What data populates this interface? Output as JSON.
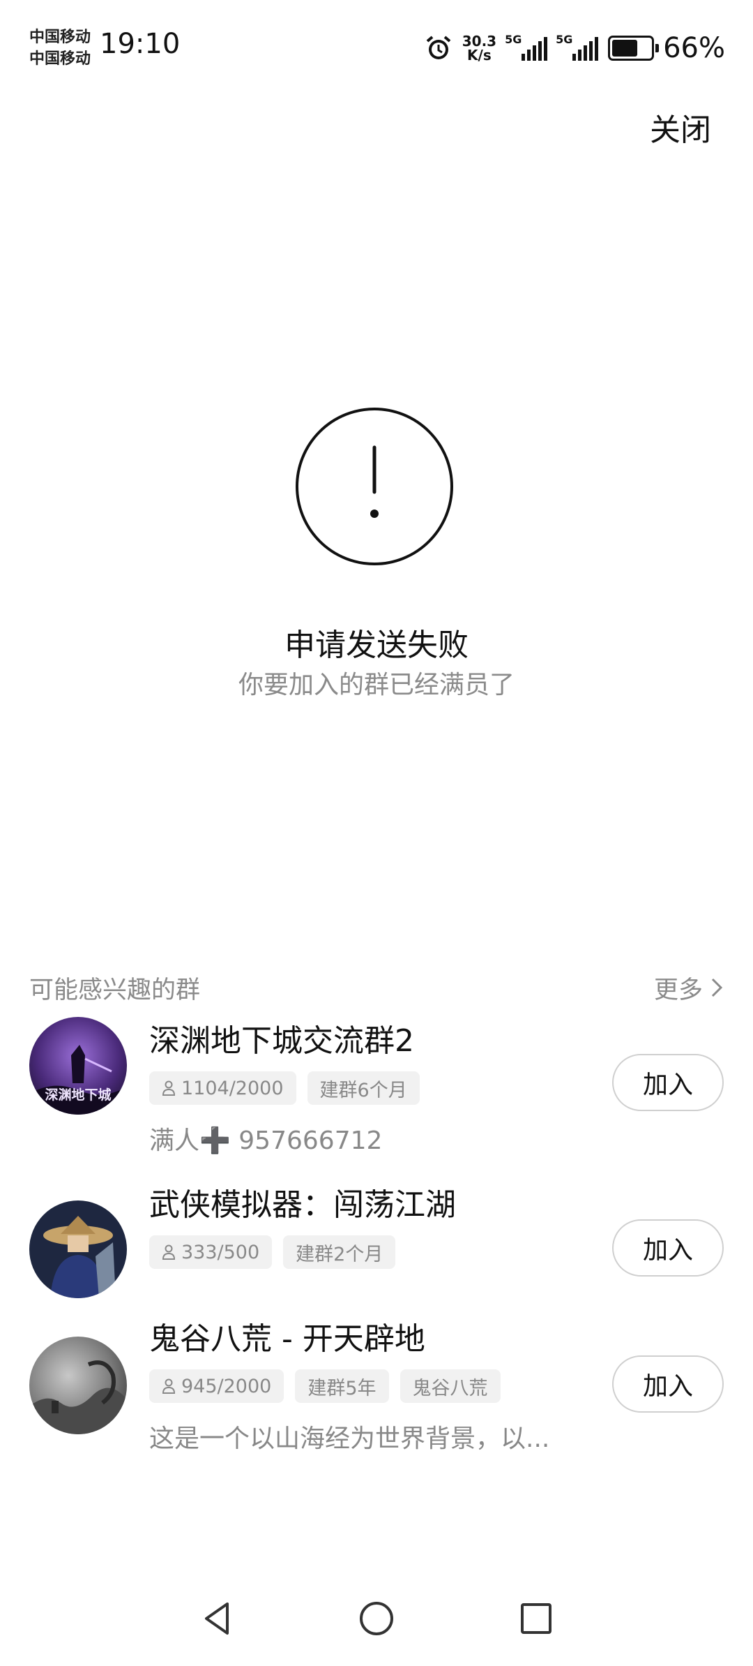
{
  "status_bar": {
    "carrier_1": "中国移动",
    "carrier_2": "中国移动",
    "time": "19:10",
    "net_speed_value": "30.3",
    "net_speed_unit": "K/s",
    "network_1": "5G",
    "network_2": "5G",
    "battery_percent": "66%",
    "battery_level": 0.66
  },
  "header": {
    "close_label": "关闭"
  },
  "result": {
    "icon": "exclamation-circle-icon",
    "title": "申请发送失败",
    "subtitle": "你要加入的群已经满员了"
  },
  "recommend": {
    "section_title": "可能感兴趣的群",
    "more_label": "更多",
    "groups": [
      {
        "name": "深渊地下城交流群2",
        "members": "1104/2000",
        "age": "建群6个月",
        "desc": "满人➕ 957666712",
        "join_label": "加入",
        "avatar_text": "深渊地下城"
      },
      {
        "name": "武侠模拟器：闯荡江湖",
        "members": "333/500",
        "age": "建群2个月",
        "join_label": "加入"
      },
      {
        "name": "鬼谷八荒 - 开天辟地",
        "members": "945/2000",
        "age": "建群5年",
        "category": "鬼谷八荒",
        "desc": "这是一个以山海经为世界背景，以...",
        "join_label": "加入"
      }
    ]
  },
  "nav": {
    "back": "back-triangle-icon",
    "home": "home-circle-icon",
    "recents": "recents-square-icon"
  }
}
